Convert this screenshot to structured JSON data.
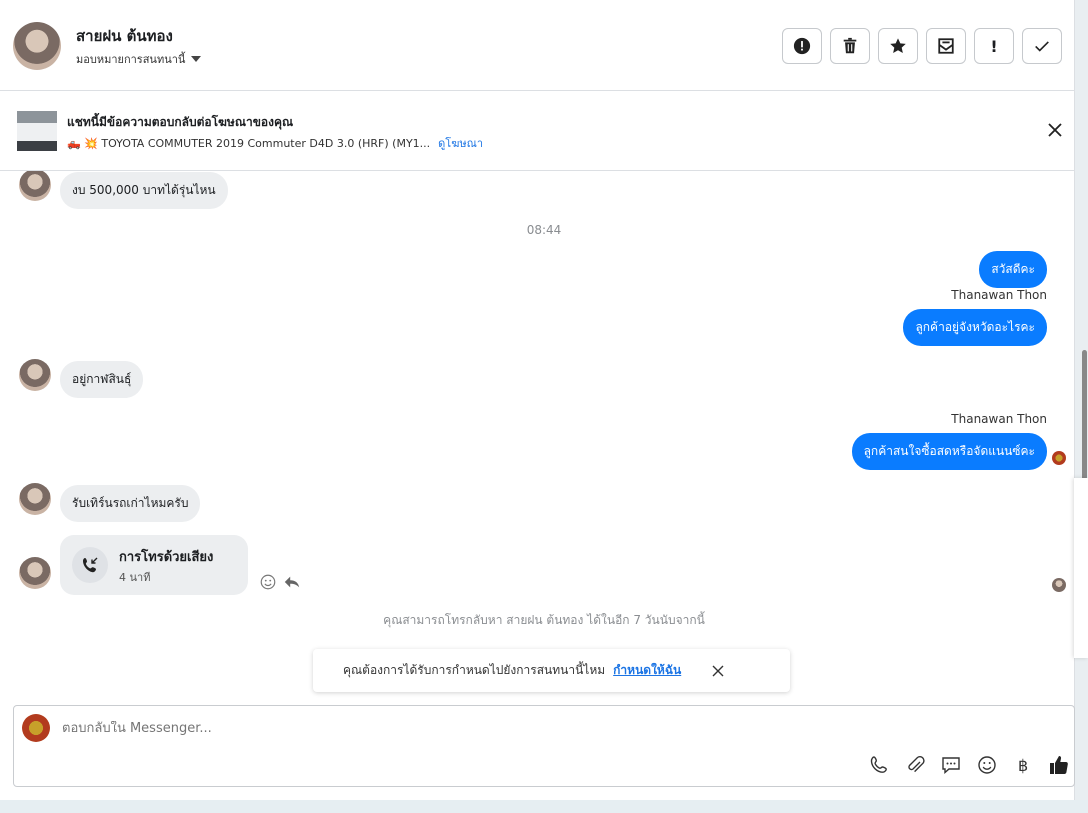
{
  "header": {
    "contact_name": "สายฝน ต้นทอง",
    "assign_label": "มอบหมายการสนทนานี้",
    "actions": [
      {
        "name": "report-button",
        "icon": "alert-circle-icon",
        "label": ""
      },
      {
        "name": "delete-button",
        "icon": "trash-icon",
        "label": ""
      },
      {
        "name": "star-button",
        "icon": "star-icon",
        "label": ""
      },
      {
        "name": "archive-button",
        "icon": "mail-archive-icon",
        "label": ""
      },
      {
        "name": "mark-button",
        "icon": "exclamation-icon",
        "label": "!"
      },
      {
        "name": "done-button",
        "icon": "check-icon",
        "label": ""
      }
    ]
  },
  "ad": {
    "title": "แชทนี้มีข้อความตอบกลับต่อโฆษณาของคุณ",
    "vehicle": "🛻 💥 TOYOTA COMMUTER 2019 Commuter D4D 3.0 (HRF) (MY1...",
    "link_label": "ดูโฆษณา"
  },
  "thread": {
    "msg1": "งบ 500,000 บาทได้รุ่นไหน",
    "time1": "08:44",
    "out1": "สวัสดีคะ",
    "sender1": "Thanawan Thon",
    "out2": "ลูกค้าอยู่จังหวัดอะไรคะ",
    "msg2": "อยู่กาฬสินธุ์",
    "sender2": "Thanawan Thon",
    "out3": "ลูกค้าสนใจซื้อสดหรือจัดแนนซ์คะ",
    "msg3": "รับเทิร์นรถเก่าไหมครับ",
    "call_title": "การโทรด้วยเสียง",
    "call_duration": "4 นาที",
    "callback_notice": "คุณสามารถโทรกลับหา สายฝน ต้นทอง ได้ในอีก 7 วันนับจากนี้"
  },
  "toast": {
    "text": "คุณต้องการได้รับการกำหนดไปยังการสนทนานี้ไหม",
    "link": "กำหนดให้ฉัน"
  },
  "composer": {
    "placeholder": "ตอบกลับใน Messenger...",
    "tools": [
      "phone-icon",
      "paperclip-icon",
      "chat-bubble-icon",
      "emoji-icon",
      "baht-icon",
      "thumbs-up-icon"
    ]
  },
  "colors": {
    "outgoing_bubble": "#0a7cff",
    "incoming_bubble": "#eceef0",
    "link": "#1b74e4"
  }
}
